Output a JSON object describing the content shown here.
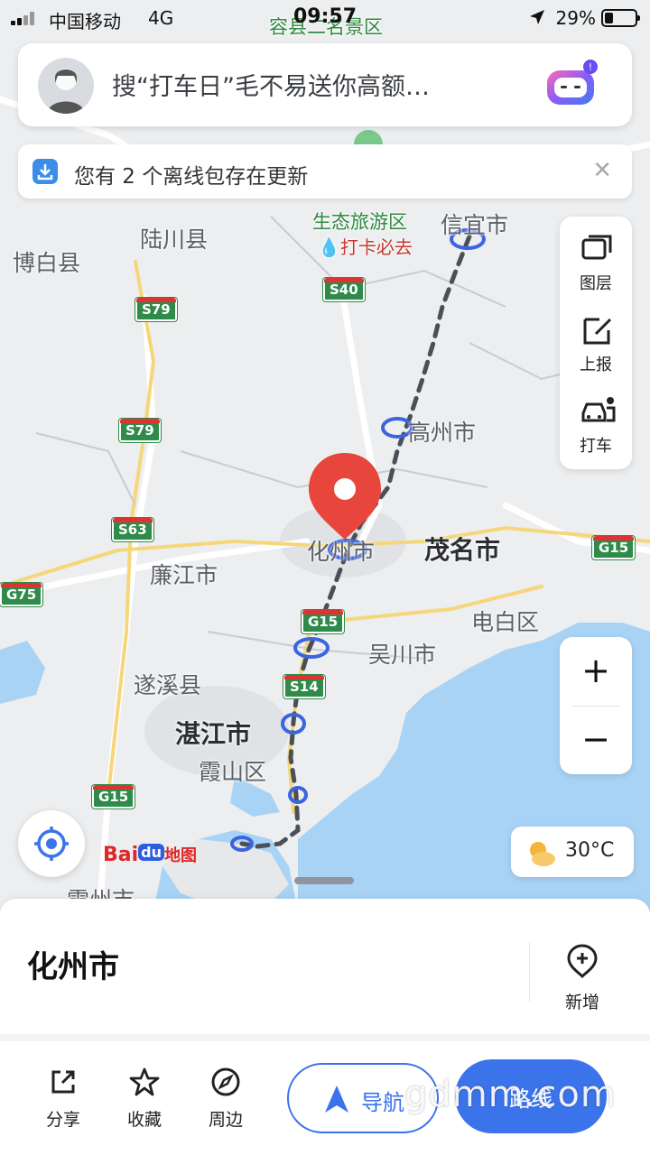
{
  "status_bar": {
    "carrier": "中国移动",
    "network": "4G",
    "time": "09:57",
    "battery_percent": "29%",
    "battery_level": 0.29
  },
  "search": {
    "placeholder": "搜“打车日”毛不易送你高额…"
  },
  "offline_banner": {
    "text": "您有 2 个离线包存在更新"
  },
  "map": {
    "places": {
      "top_scenic": "容县二名景区",
      "luchuan": "陆川县",
      "bobai": "博白县",
      "xinyi": "信宜市",
      "eco_zone": "生态旅游区",
      "checkin": "打卡必去",
      "gaozhou": "高州市",
      "huazhou": "化州市",
      "maoming": "茂名市",
      "lianjiang": "廉江市",
      "dianbai": "电白区",
      "wuchuan": "吴川市",
      "suixi": "遂溪县",
      "zhanjiang": "湛江市",
      "xiashan": "霞山区",
      "leizhou": "雷州市"
    },
    "shields": {
      "s40": "S40",
      "s79a": "S79",
      "s79b": "S79",
      "s63": "S63",
      "g75": "G75",
      "g15a": "G15",
      "g15b": "G15",
      "g15c": "G15",
      "s14": "S14"
    },
    "logo_text": "Bai",
    "logo_paw": "du",
    "logo_suffix": "地图"
  },
  "tools": {
    "layers": "图层",
    "report": "上报",
    "taxi": "打车"
  },
  "zoom": {
    "in": "+",
    "out": "−"
  },
  "weather": {
    "temp": "30°C"
  },
  "sheet": {
    "title": "化州市",
    "add_label": "新增",
    "actions": {
      "share": "分享",
      "favorite": "收藏",
      "nearby": "周边"
    },
    "navigate": "导航",
    "route": "路线",
    "watermark": "gdmm.com"
  },
  "colors": {
    "accent": "#3b73ea",
    "pin": "#e8453c",
    "water": "#a9d3f5",
    "highway": "#2e8b4a"
  }
}
